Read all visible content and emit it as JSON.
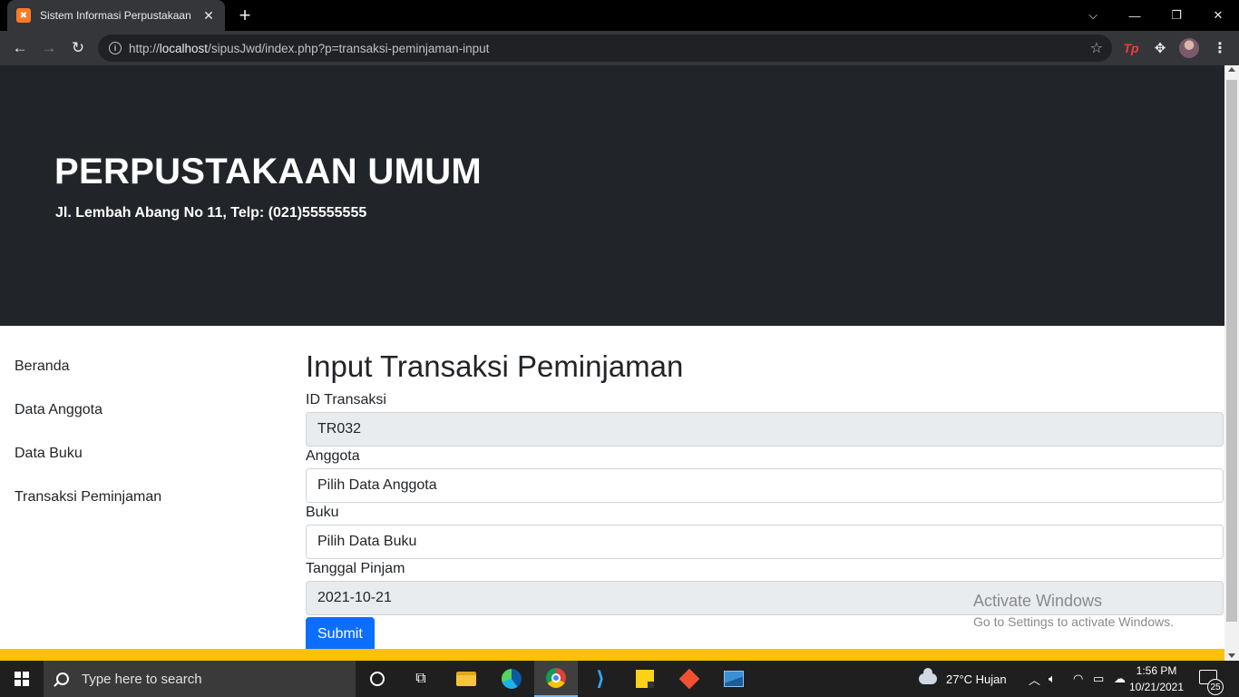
{
  "browser": {
    "tab_title": "Sistem Informasi Perpustakaan",
    "tab_favicon": "xampp-icon",
    "url_prefix": "http://",
    "url_host": "localhost",
    "url_path": "/sipusJwd/index.php?p=transaksi-peminjaman-input",
    "extension_label": "Tp"
  },
  "hero": {
    "title": "PERPUSTAKAAN UMUM",
    "subtitle": "Jl. Lembah Abang No 11, Telp: (021)55555555"
  },
  "sidebar": {
    "items": [
      {
        "label": "Beranda"
      },
      {
        "label": "Data Anggota"
      },
      {
        "label": "Data Buku"
      },
      {
        "label": "Transaksi Peminjaman"
      }
    ]
  },
  "form": {
    "title": "Input Transaksi Peminjaman",
    "id_label": "ID Transaksi",
    "id_value": "TR032",
    "member_label": "Anggota",
    "member_value": "Pilih Data Anggota",
    "book_label": "Buku",
    "book_value": "Pilih Data Buku",
    "date_label": "Tanggal Pinjam",
    "date_value": "2021-10-21",
    "submit_label": "Submit"
  },
  "watermark": {
    "title": "Activate Windows",
    "subtitle": "Go to Settings to activate Windows."
  },
  "taskbar": {
    "search_placeholder": "Type here to search",
    "weather": "27°C  Hujan",
    "time": "1:56 PM",
    "date": "10/21/2021",
    "notification_count": "25"
  },
  "colors": {
    "hero_bg": "#212529",
    "footer_band": "#ffc107",
    "primary_button": "#0d6efd",
    "readonly_field": "#e9ecef"
  }
}
